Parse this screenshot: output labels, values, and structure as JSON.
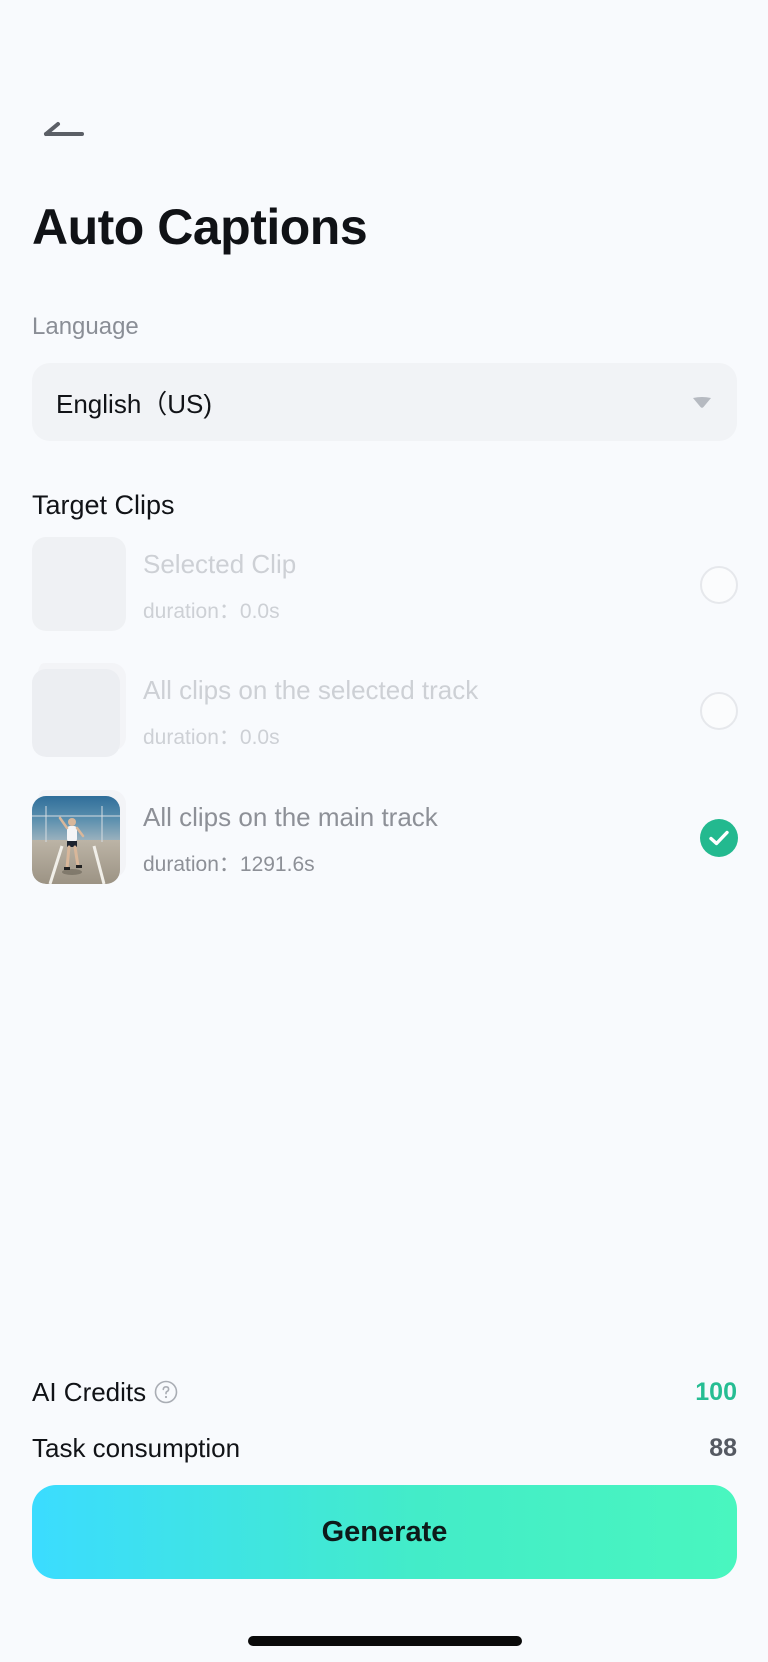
{
  "header": {
    "title": "Auto Captions",
    "back_icon": "back-arrow-icon"
  },
  "language": {
    "label": "Language",
    "selected": "English（US)",
    "caret_icon": "caret-down-icon"
  },
  "target_clips": {
    "title": "Target Clips",
    "items": [
      {
        "name": "Selected Clip",
        "duration_label": "duration：",
        "duration": "0.0s",
        "selected": false,
        "disabled": true
      },
      {
        "name": "All clips on the selected track",
        "duration_label": "duration：",
        "duration": "0.0s",
        "selected": false,
        "disabled": true
      },
      {
        "name": "All clips on the main track",
        "duration_label": "duration：",
        "duration": "1291.6s",
        "selected": true,
        "disabled": false
      }
    ]
  },
  "credits": {
    "label": "AI Credits",
    "value": "100",
    "help_icon": "help-circle-icon"
  },
  "consumption": {
    "label": "Task consumption",
    "value": "88"
  },
  "actions": {
    "generate_label": "Generate"
  },
  "colors": {
    "accent": "#23b98f",
    "button_gradient_start": "#3bdcff",
    "button_gradient_end": "#49f6bf",
    "background": "#f8fafd"
  }
}
